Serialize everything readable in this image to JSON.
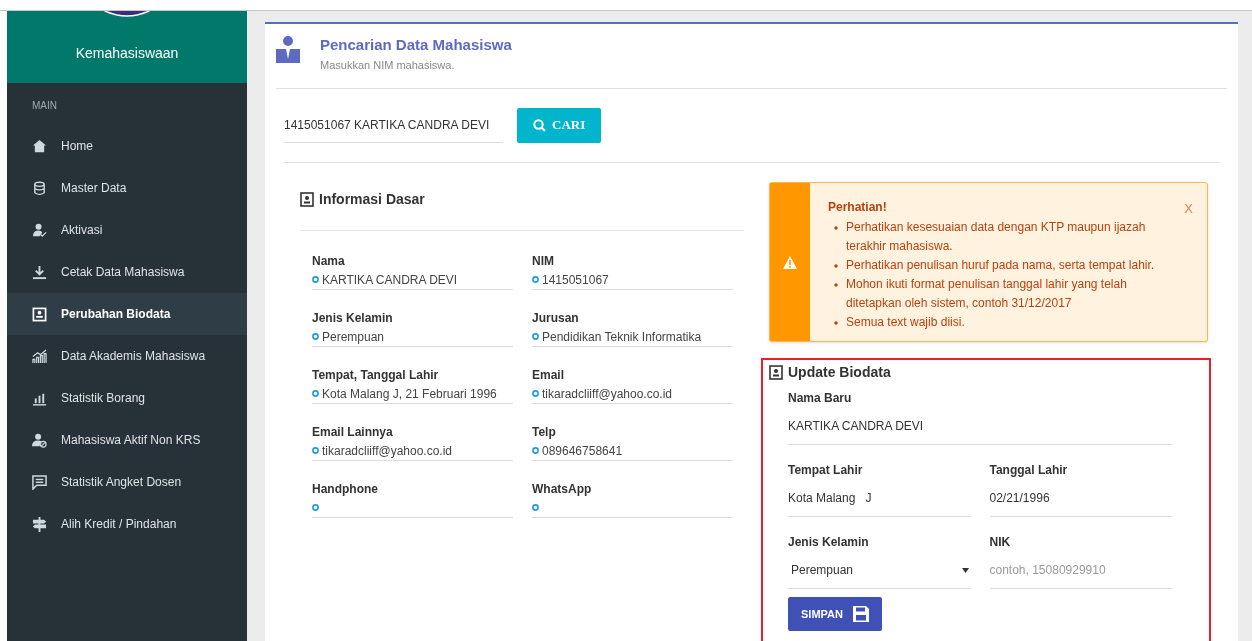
{
  "sidebar": {
    "brand": "Kemahasiswaan",
    "section": "MAIN",
    "items": [
      {
        "label": "Home",
        "selected": false
      },
      {
        "label": "Master Data",
        "selected": false
      },
      {
        "label": "Aktivasi",
        "selected": false
      },
      {
        "label": "Cetak Data Mahasiswa",
        "selected": false
      },
      {
        "label": "Perubahan Biodata",
        "selected": true
      },
      {
        "label": "Data Akademis Mahasiswa",
        "selected": false
      },
      {
        "label": "Statistik Borang",
        "selected": false
      },
      {
        "label": "Mahasiswa Aktif Non KRS",
        "selected": false
      },
      {
        "label": "Statistik Angket Dosen",
        "selected": false
      },
      {
        "label": "Alih Kredit / Pindahan",
        "selected": false
      }
    ]
  },
  "header": {
    "title": "Pencarian Data Mahasiswa",
    "subtitle": "Masukkan NIM mahasiswa."
  },
  "search": {
    "value": "1415051067 KARTIKA CANDRA DEVI",
    "button": "CARI"
  },
  "info": {
    "title": "Informasi Dasar",
    "fields": [
      {
        "label": "Nama",
        "value": "KARTIKA CANDRA DEVI"
      },
      {
        "label": "NIM",
        "value": "1415051067"
      },
      {
        "label": "Jenis Kelamin",
        "value": "Perempuan"
      },
      {
        "label": "Jurusan",
        "value": "Pendidikan Teknik Informatika"
      },
      {
        "label": "Tempat, Tanggal Lahir",
        "value": "Kota Malang J, 21 Februari 1996"
      },
      {
        "label": "Email",
        "value": "tikaradcliiff@yahoo.co.id"
      },
      {
        "label": "Email Lainnya",
        "value": "tikaradcliiff@yahoo.co.id"
      },
      {
        "label": "Telp",
        "value": "089646758641"
      },
      {
        "label": "Handphone"
      },
      {
        "label": "WhatsApp"
      }
    ]
  },
  "alert": {
    "title": "Perhatian!",
    "close": "X",
    "items": [
      "Perhatikan kesesuaian data dengan KTP maupun ijazah terakhir mahasiswa.",
      "Perhatikan penulisan huruf pada nama, serta tempat lahir.",
      "Mohon ikuti format penulisan tanggal lahir yang telah ditetapkan oleh sistem, contoh 31/12/2017",
      "Semua text wajib diisi."
    ]
  },
  "update": {
    "title": "Update Biodata",
    "fields": [
      {
        "kind": "text",
        "label": "Nama Baru",
        "value": "KARTIKA CANDRA DEVI",
        "wide": true
      },
      {
        "kind": "text",
        "label": "Tempat Lahir",
        "value": "Kota Malang   J"
      },
      {
        "kind": "text",
        "label": "Tanggal Lahir",
        "value": "02/21/1996"
      },
      {
        "kind": "select",
        "label": "Jenis Kelamin",
        "value": "Perempuan"
      },
      {
        "kind": "text",
        "label": "NIK",
        "placeholder": "contoh, 15080929910"
      }
    ],
    "button": "SIMPAN"
  }
}
